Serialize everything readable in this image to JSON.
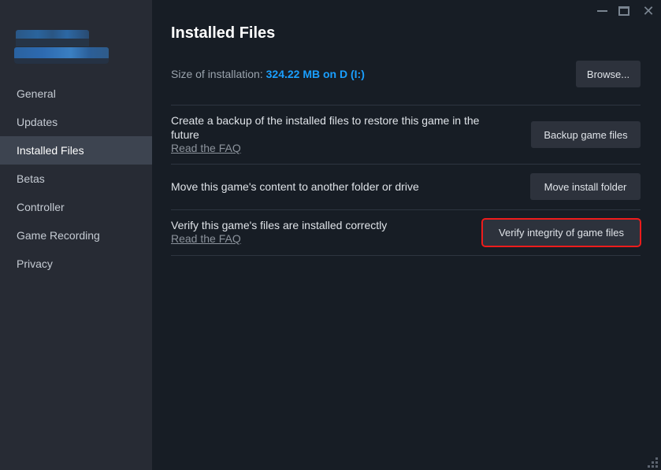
{
  "window": {
    "controls": {
      "minimize": "minimize-icon",
      "maximize": "maximize-icon",
      "close": "✕"
    }
  },
  "sidebar": {
    "items": [
      {
        "label": "General",
        "active": false
      },
      {
        "label": "Updates",
        "active": false
      },
      {
        "label": "Installed Files",
        "active": true
      },
      {
        "label": "Betas",
        "active": false
      },
      {
        "label": "Controller",
        "active": false
      },
      {
        "label": "Game Recording",
        "active": false
      },
      {
        "label": "Privacy",
        "active": false
      }
    ]
  },
  "main": {
    "title": "Installed Files",
    "size_label": "Size of installation:",
    "size_value": "324.22 MB on D (I:)",
    "browse_label": "Browse...",
    "rows": [
      {
        "text": "Create a backup of the installed files to restore this game in the future",
        "link": "Read the FAQ",
        "button": "Backup game files"
      },
      {
        "text": "Move this game's content to another folder or drive",
        "button": "Move install folder"
      },
      {
        "text": "Verify this game's files are installed correctly",
        "link": "Read the FAQ",
        "button": "Verify integrity of game files",
        "highlighted": true
      }
    ]
  },
  "colors": {
    "accent": "#1a9fff",
    "highlight": "#ee1c1c"
  }
}
